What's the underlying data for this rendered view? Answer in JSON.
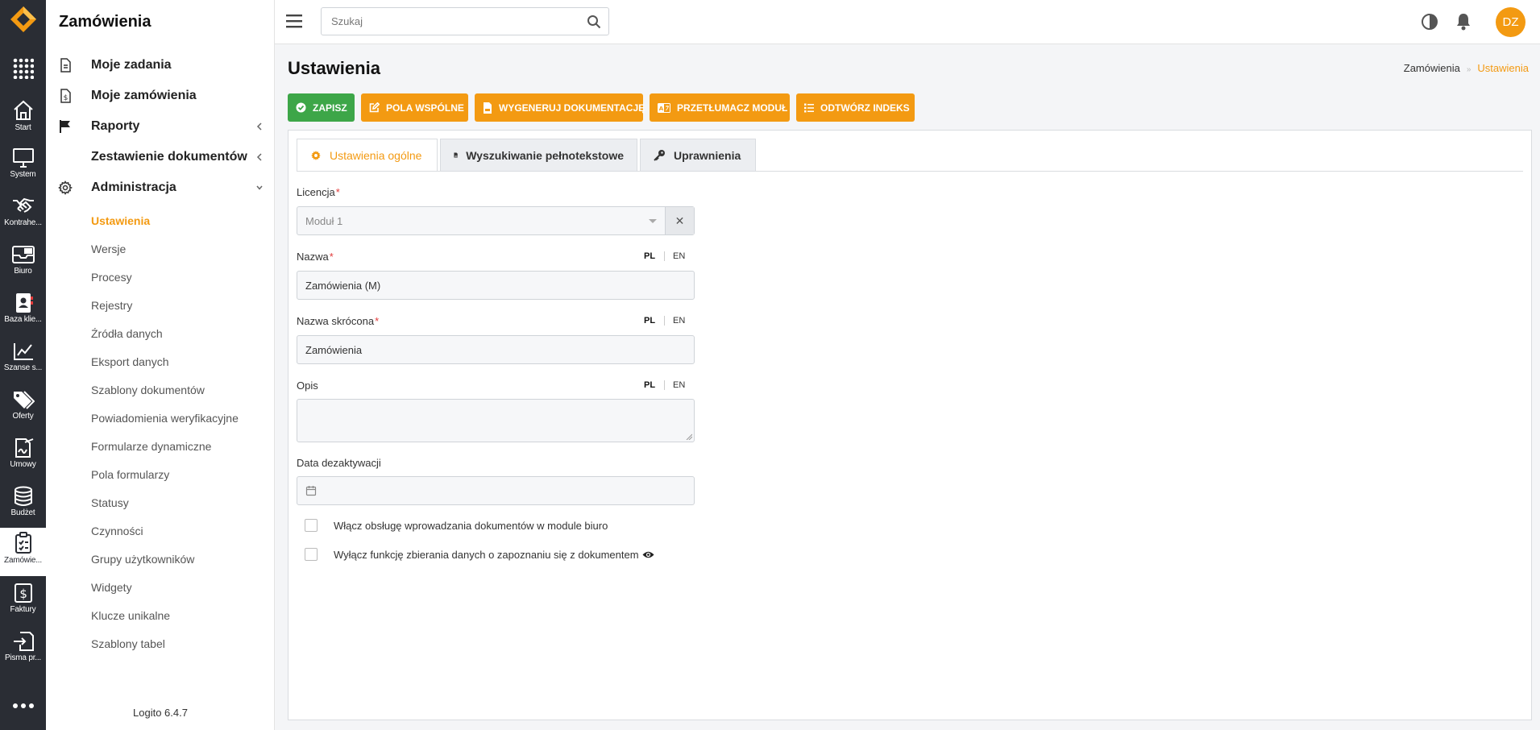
{
  "app": {
    "version": "Logito 6.4.7"
  },
  "rail": {
    "items": [
      {
        "label": "Start",
        "icon": "home-icon"
      },
      {
        "label": "System",
        "icon": "monitor-icon"
      },
      {
        "label": "Kontrahe...",
        "icon": "handshake-icon"
      },
      {
        "label": "Biuro",
        "icon": "mail-tray-icon"
      },
      {
        "label": "Baza klie...",
        "icon": "contact-book-icon"
      },
      {
        "label": "Szanse s...",
        "icon": "chart-line-icon"
      },
      {
        "label": "Oferty",
        "icon": "tags-icon"
      },
      {
        "label": "Umowy",
        "icon": "signature-icon"
      },
      {
        "label": "Budżet",
        "icon": "database-icon"
      },
      {
        "label": "Zamówie...",
        "icon": "clipboard-list-icon"
      },
      {
        "label": "Faktury",
        "icon": "dollar-icon"
      },
      {
        "label": "Pisma pr...",
        "icon": "sign-in-icon"
      }
    ],
    "active_index": 9
  },
  "sidemenu": {
    "title": "Zamówienia",
    "items": [
      {
        "label": "Moje zadania",
        "icon": "file-icon"
      },
      {
        "label": "Moje zamówienia",
        "icon": "file-dollar-icon"
      },
      {
        "label": "Raporty",
        "icon": "flag-icon"
      },
      {
        "label": "Zestawienie dokumentów",
        "icon": ""
      },
      {
        "label": "Administracja",
        "icon": "gear-icon"
      }
    ],
    "admin_subitems": [
      "Ustawienia",
      "Wersje",
      "Procesy",
      "Rejestry",
      "Źródła danych",
      "Eksport danych",
      "Szablony dokumentów",
      "Powiadomienia weryfikacyjne",
      "Formularze dynamiczne",
      "Pola formularzy",
      "Statusy",
      "Czynności",
      "Grupy użytkowników",
      "Widgety",
      "Klucze unikalne",
      "Szablony tabel"
    ],
    "active_subitem": "Ustawienia"
  },
  "topbar": {
    "search_placeholder": "Szukaj",
    "avatar_initials": "DZ"
  },
  "page": {
    "title": "Ustawienia",
    "breadcrumb": [
      "Zamówienia",
      "Ustawienia"
    ]
  },
  "toolbar": {
    "buttons": [
      {
        "label": "ZAPISZ",
        "icon": "check-circle-icon",
        "color": "#3da648"
      },
      {
        "label": "POLA WSPÓLNE",
        "icon": "edit-icon",
        "color": "#f39a12"
      },
      {
        "label": "WYGENERUJ DOKUMENTACJĘ",
        "icon": "file-pdf-icon",
        "color": "#f39a12"
      },
      {
        "label": "PRZETŁUMACZ MODUŁ",
        "icon": "translate-icon",
        "color": "#f39a12"
      },
      {
        "label": "ODTWÓRZ INDEKS",
        "icon": "list-icon",
        "color": "#f39a12"
      }
    ]
  },
  "tabs": [
    {
      "label": "Ustawienia ogólne",
      "icon": "gear-icon",
      "active": true
    },
    {
      "label": "Wyszukiwanie pełnotekstowe",
      "icon": "file-pdf-icon",
      "active": false
    },
    {
      "label": "Uprawnienia",
      "icon": "key-icon",
      "active": false
    }
  ],
  "form": {
    "licencja": {
      "label": "Licencja",
      "required": "*",
      "value": "Moduł 1",
      "clear": "✕"
    },
    "nazwa": {
      "label": "Nazwa",
      "required": "*",
      "value": "Zamówienia (M)"
    },
    "nazwa_skrocona": {
      "label": "Nazwa skrócona",
      "required": "*",
      "value": "Zamówienia"
    },
    "opis": {
      "label": "Opis",
      "value": ""
    },
    "data_dezaktywacji": {
      "label": "Data dezaktywacji",
      "value": ""
    },
    "lang": {
      "pl": "PL",
      "en": "EN"
    },
    "checkboxes": [
      {
        "label": "Włącz obsługę wprowadzania dokumentów w module biuro",
        "checked": false
      },
      {
        "label": "Wyłącz funkcję zbierania danych o zapoznaniu się z dokumentem",
        "checked": false
      }
    ]
  },
  "colors": {
    "accent": "#f39a12",
    "success": "#3da648",
    "rail": "#2a2d34",
    "required": "#e23b3b"
  }
}
